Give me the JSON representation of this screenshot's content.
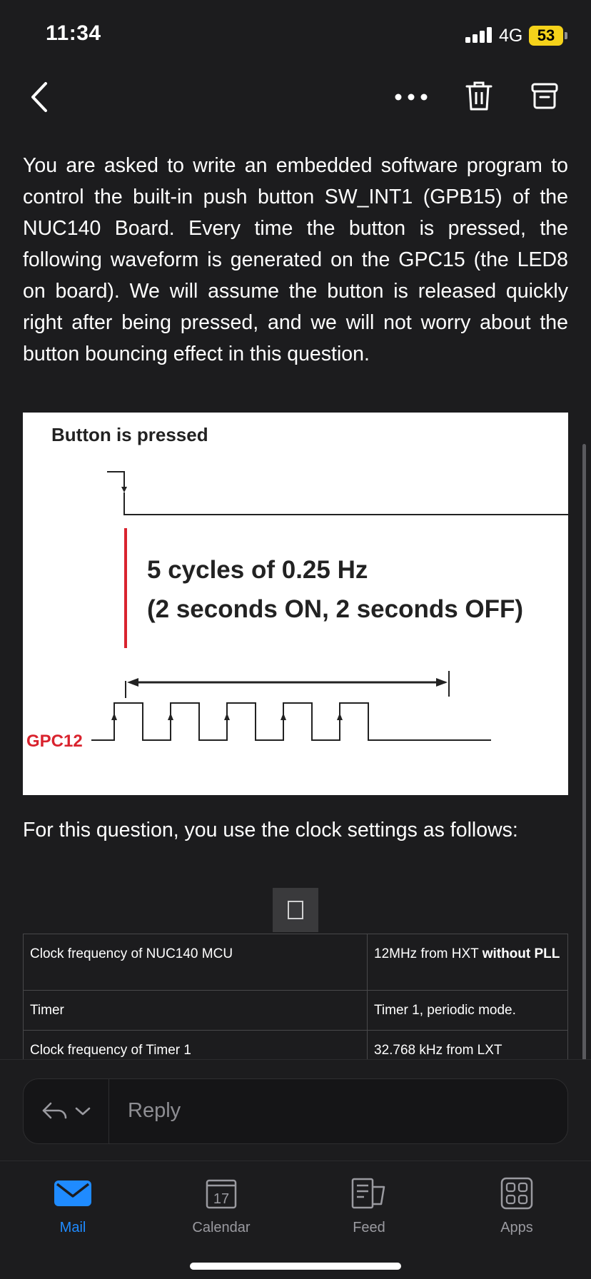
{
  "status_bar": {
    "time": "11:34",
    "network": "4G",
    "battery": "53"
  },
  "toolbar": {
    "back": "back",
    "more": "more",
    "trash": "delete",
    "archive": "archive"
  },
  "email": {
    "paragraph1": "You are asked to write an embedded software program to control the built-in push button SW_INT1 (GPB15) of the NUC140 Board. Every time the button is pressed, the following waveform is generated on the GPC15 (the LED8 on board). We will assume the button is released quickly right after being pressed, and we will not worry about the button bouncing effect in this question.",
    "figure": {
      "title": "Button is pressed",
      "line1": "5 cycles of 0.25 Hz",
      "line2": "(2 seconds ON, 2 seconds OFF)",
      "signal_label": "GPC12",
      "pulse_count": 5
    },
    "paragraph2": "For this question, you use the clock settings as follows:",
    "clock_table": [
      {
        "name": "Clock frequency of NUC140 MCU",
        "value_plain": "12MHz from HXT ",
        "value_bold": "without PLL"
      },
      {
        "name": "Timer",
        "value_plain": "Timer 1, periodic mode.",
        "value_bold": ""
      },
      {
        "name": "Clock frequency of Timer 1",
        "value_plain": "32.768 kHz from LXT",
        "value_bold": ""
      }
    ]
  },
  "reply": {
    "placeholder": "Reply"
  },
  "tabs": [
    {
      "label": "Mail",
      "icon": "mail-icon",
      "active": true
    },
    {
      "label": "Calendar",
      "icon": "calendar-icon",
      "day": "17",
      "active": false
    },
    {
      "label": "Feed",
      "icon": "feed-icon",
      "active": false
    },
    {
      "label": "Apps",
      "icon": "apps-icon",
      "active": false
    }
  ],
  "colors": {
    "accent": "#1f8bff",
    "battery": "#f5d21a",
    "figure_red": "#d9232e",
    "background": "#1c1c1e"
  }
}
